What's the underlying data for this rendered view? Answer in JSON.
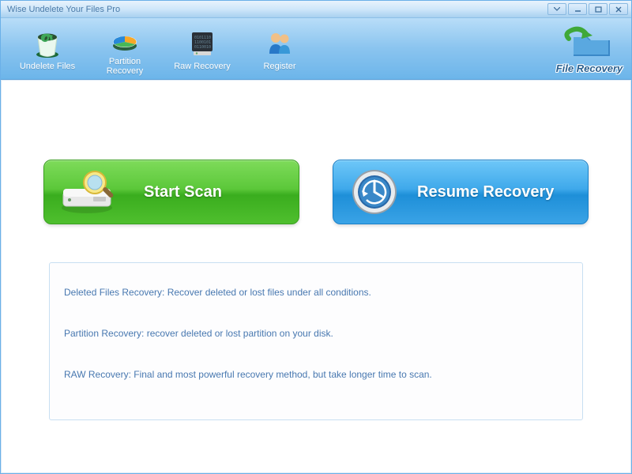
{
  "window": {
    "title": "Wise Undelete Your Files Pro"
  },
  "toolbar": {
    "items": [
      {
        "label": "Undelete Files"
      },
      {
        "label": "Partition\nRecovery"
      },
      {
        "label": "Raw Recovery"
      },
      {
        "label": "Register"
      }
    ],
    "brand": "File Recovery"
  },
  "main": {
    "start_scan": "Start  Scan",
    "resume_recovery": "Resume Recovery"
  },
  "info": {
    "line1": "Deleted Files Recovery: Recover deleted or lost files  under all conditions.",
    "line2": "Partition Recovery: recover deleted or lost partition on your disk.",
    "line3": "RAW Recovery: Final and most powerful recovery method, but take longer time to scan."
  }
}
